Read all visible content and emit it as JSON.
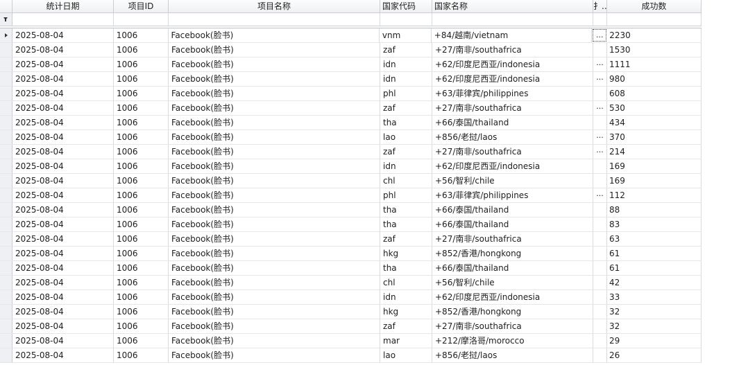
{
  "columns": {
    "date": "统计日期",
    "project_id": "项目ID",
    "project_name": "项目名称",
    "country_code": "国家代码",
    "country_name": "国家名称",
    "truncated": "扌..",
    "success_count": "成功数"
  },
  "rows": [
    {
      "date": "2025-08-04",
      "id": "1006",
      "name": "Facebook(脸书)",
      "code": "vnm",
      "country": "+84/越南/vietnam",
      "dots": "...",
      "count": "2230"
    },
    {
      "date": "2025-08-04",
      "id": "1006",
      "name": "Facebook(脸书)",
      "code": "zaf",
      "country": "+27/南非/southafrica",
      "dots": "",
      "count": "1530"
    },
    {
      "date": "2025-08-04",
      "id": "1006",
      "name": "Facebook(脸书)",
      "code": "idn",
      "country": "+62/印度尼西亚/indonesia",
      "dots": "...",
      "count": "1111"
    },
    {
      "date": "2025-08-04",
      "id": "1006",
      "name": "Facebook(脸书)",
      "code": "idn",
      "country": "+62/印度尼西亚/indonesia",
      "dots": "...",
      "count": "980"
    },
    {
      "date": "2025-08-04",
      "id": "1006",
      "name": "Facebook(脸书)",
      "code": "phl",
      "country": "+63/菲律宾/philippines",
      "dots": "",
      "count": "608"
    },
    {
      "date": "2025-08-04",
      "id": "1006",
      "name": "Facebook(脸书)",
      "code": "zaf",
      "country": "+27/南非/southafrica",
      "dots": "...",
      "count": "530"
    },
    {
      "date": "2025-08-04",
      "id": "1006",
      "name": "Facebook(脸书)",
      "code": "tha",
      "country": "+66/泰国/thailand",
      "dots": "",
      "count": "434"
    },
    {
      "date": "2025-08-04",
      "id": "1006",
      "name": "Facebook(脸书)",
      "code": "lao",
      "country": "+856/老挝/laos",
      "dots": "...",
      "count": "370"
    },
    {
      "date": "2025-08-04",
      "id": "1006",
      "name": "Facebook(脸书)",
      "code": "zaf",
      "country": "+27/南非/southafrica",
      "dots": "...",
      "count": "214"
    },
    {
      "date": "2025-08-04",
      "id": "1006",
      "name": "Facebook(脸书)",
      "code": "idn",
      "country": "+62/印度尼西亚/indonesia",
      "dots": "",
      "count": "169"
    },
    {
      "date": "2025-08-04",
      "id": "1006",
      "name": "Facebook(脸书)",
      "code": "chl",
      "country": "+56/智利/chile",
      "dots": "",
      "count": "169"
    },
    {
      "date": "2025-08-04",
      "id": "1006",
      "name": "Facebook(脸书)",
      "code": "phl",
      "country": "+63/菲律宾/philippines",
      "dots": "...",
      "count": "112"
    },
    {
      "date": "2025-08-04",
      "id": "1006",
      "name": "Facebook(脸书)",
      "code": "tha",
      "country": "+66/泰国/thailand",
      "dots": "",
      "count": "88"
    },
    {
      "date": "2025-08-04",
      "id": "1006",
      "name": "Facebook(脸书)",
      "code": "tha",
      "country": "+66/泰国/thailand",
      "dots": "",
      "count": "83"
    },
    {
      "date": "2025-08-04",
      "id": "1006",
      "name": "Facebook(脸书)",
      "code": "zaf",
      "country": "+27/南非/southafrica",
      "dots": "",
      "count": "63"
    },
    {
      "date": "2025-08-04",
      "id": "1006",
      "name": "Facebook(脸书)",
      "code": "hkg",
      "country": "+852/香港/hongkong",
      "dots": "",
      "count": "61"
    },
    {
      "date": "2025-08-04",
      "id": "1006",
      "name": "Facebook(脸书)",
      "code": "tha",
      "country": "+66/泰国/thailand",
      "dots": "",
      "count": "61"
    },
    {
      "date": "2025-08-04",
      "id": "1006",
      "name": "Facebook(脸书)",
      "code": "chl",
      "country": "+56/智利/chile",
      "dots": "",
      "count": "42"
    },
    {
      "date": "2025-08-04",
      "id": "1006",
      "name": "Facebook(脸书)",
      "code": "idn",
      "country": "+62/印度尼西亚/indonesia",
      "dots": "",
      "count": "33"
    },
    {
      "date": "2025-08-04",
      "id": "1006",
      "name": "Facebook(脸书)",
      "code": "hkg",
      "country": "+852/香港/hongkong",
      "dots": "",
      "count": "32"
    },
    {
      "date": "2025-08-04",
      "id": "1006",
      "name": "Facebook(脸书)",
      "code": "zaf",
      "country": "+27/南非/southafrica",
      "dots": "",
      "count": "32"
    },
    {
      "date": "2025-08-04",
      "id": "1006",
      "name": "Facebook(脸书)",
      "code": "mar",
      "country": "+212/摩洛哥/morocco",
      "dots": "",
      "count": "29"
    },
    {
      "date": "2025-08-04",
      "id": "1006",
      "name": "Facebook(脸书)",
      "code": "lao",
      "country": "+856/老挝/laos",
      "dots": "",
      "count": "26"
    }
  ]
}
